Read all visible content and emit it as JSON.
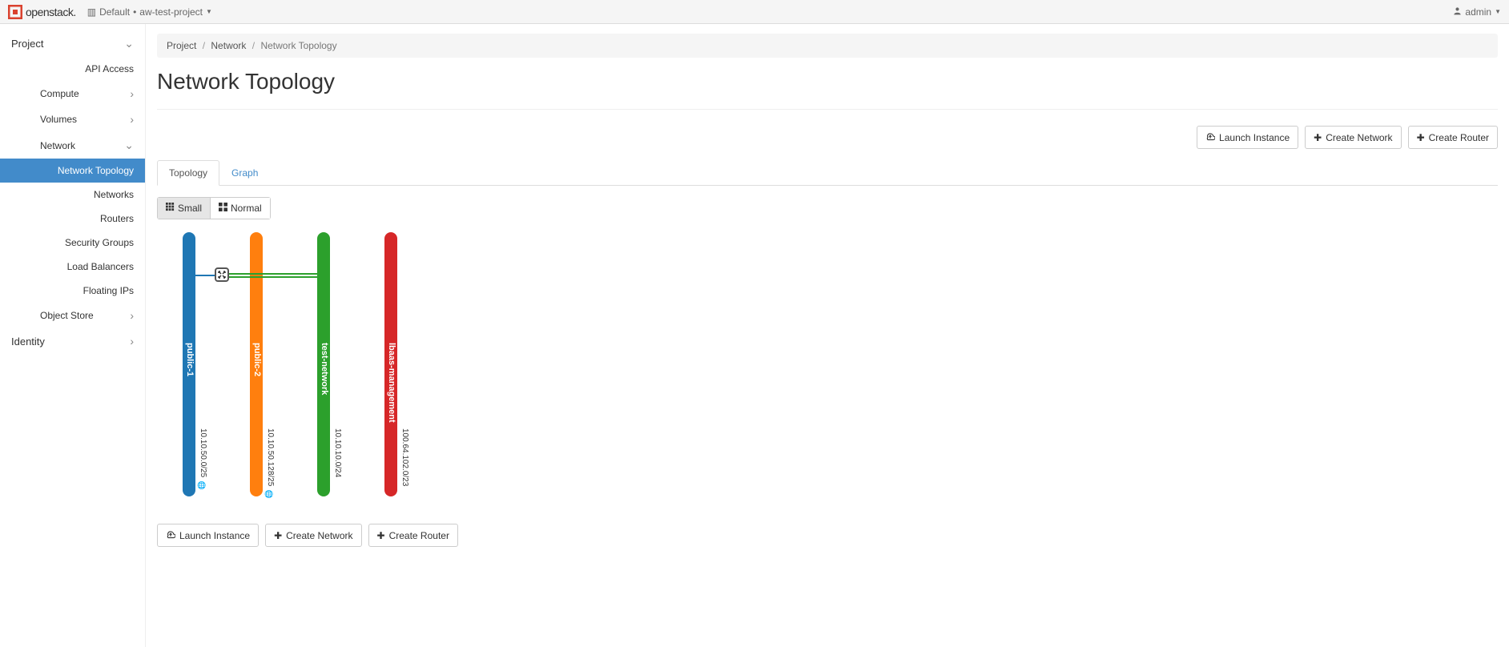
{
  "brand": "openstack.",
  "topbar": {
    "domain_label": "Default",
    "project_label": "aw-test-project",
    "user_label": "admin"
  },
  "sidebar": {
    "project": "Project",
    "api_access": "API Access",
    "compute": "Compute",
    "volumes": "Volumes",
    "network": "Network",
    "network_topology": "Network Topology",
    "networks": "Networks",
    "routers": "Routers",
    "security_groups": "Security Groups",
    "load_balancers": "Load Balancers",
    "floating_ips": "Floating IPs",
    "object_store": "Object Store",
    "identity": "Identity"
  },
  "breadcrumbs": {
    "l1": "Project",
    "l2": "Network",
    "l3": "Network Topology"
  },
  "page_title": "Network Topology",
  "actions": {
    "launch_instance": "Launch Instance",
    "create_network": "Create Network",
    "create_router": "Create Router"
  },
  "tabs": {
    "topology": "Topology",
    "graph": "Graph"
  },
  "size_toggle": {
    "small": "Small",
    "normal": "Normal"
  },
  "networks": [
    {
      "name": "public-1",
      "cidr": "10.10.50.0/25",
      "color": "#1f77b4",
      "external": true
    },
    {
      "name": "public-2",
      "cidr": "10.10.50.128/25",
      "color": "#ff7f0e",
      "external": true
    },
    {
      "name": "test-network",
      "cidr": "10.10.10.0/24",
      "color": "#2ca02c",
      "external": false
    },
    {
      "name": "lbaas-management",
      "cidr": "100.64.102.0/23",
      "color": "#d62728",
      "external": false
    }
  ],
  "router": {
    "connects_from_index": 0,
    "connects_to_index": 2
  }
}
